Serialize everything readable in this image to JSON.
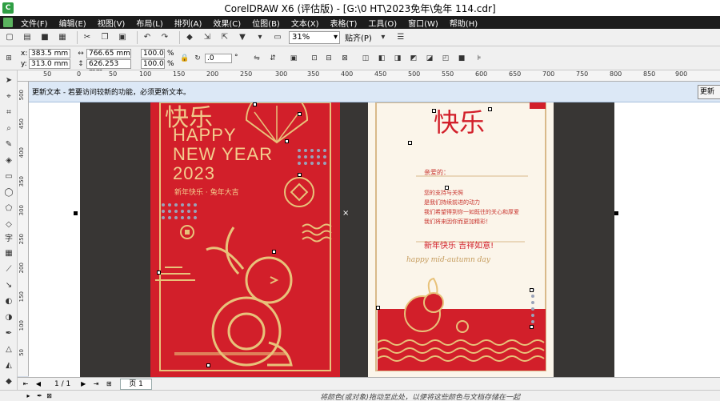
{
  "window": {
    "title": "CorelDRAW X6 (评估版) - [G:\\0 HT\\2023免年\\兔年 114.cdr]"
  },
  "menu": [
    "文件(F)",
    "编辑(E)",
    "视图(V)",
    "布局(L)",
    "排列(A)",
    "效果(C)",
    "位图(B)",
    "文本(X)",
    "表格(T)",
    "工具(O)",
    "窗口(W)",
    "帮助(H)"
  ],
  "toolbar": {
    "zoom": "31%",
    "snap_label": "贴齐(P)"
  },
  "properties": {
    "x_label": "x:",
    "x_value": "383.5 mm",
    "y_label": "y:",
    "y_value": "313.0 mm",
    "width": "766.65 mm",
    "height": "626.253 mm",
    "scale_w": "100.0",
    "scale_h": "100.0",
    "percent": "%",
    "angle": ".0",
    "angle_unit": "°"
  },
  "rulers": {
    "top_ticks": [
      "50",
      "0",
      "50",
      "100",
      "150",
      "200",
      "250",
      "300",
      "350",
      "400",
      "450",
      "500",
      "550",
      "600",
      "650",
      "700",
      "750",
      "800",
      "850",
      "900"
    ],
    "left_ticks": [
      "500",
      "450",
      "400",
      "350",
      "300",
      "250",
      "200",
      "150",
      "100",
      "50"
    ]
  },
  "notice": {
    "text": "更新文本 - 若要访问较新的功能，必须更新文本。",
    "button": "更新"
  },
  "card_left": {
    "title": "快乐",
    "line1": "HAPPY",
    "line2": "NEW YEAR",
    "line3": "2023",
    "subtitle": "新年快乐 · 兔年大吉"
  },
  "card_right": {
    "title": "快乐",
    "heading": "亲爱的：",
    "lines": [
      "您的支持与关照",
      "是我们持续前进的动力",
      "我们希望得到你一如既往的关心和厚爱",
      "我们将来因你而更加精彩！"
    ],
    "wish": "新年快乐 吉祥如意!",
    "script": "happy mid-autumn day"
  },
  "pagebar": {
    "count": "1 / 1",
    "tab": "页 1"
  },
  "status": {
    "hint": "将颜色(或对象)拖动至此处，以便将这些颜色与文档存储在一起"
  }
}
